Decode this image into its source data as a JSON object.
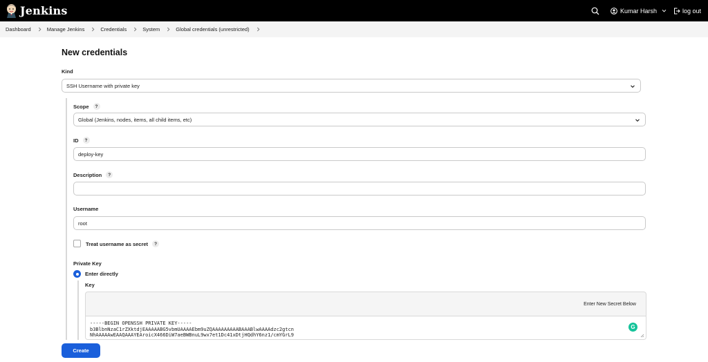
{
  "app": {
    "name": "Jenkins",
    "user_name": "Kumar Harsh",
    "logout_label": "log out",
    "accent_color": "#1a5fdb"
  },
  "breadcrumb": [
    "Dashboard",
    "Manage Jenkins",
    "Credentials",
    "System",
    "Global credentials (unrestricted)"
  ],
  "form": {
    "title": "New credentials",
    "kind": {
      "label": "Kind",
      "value": "SSH Username with private key"
    },
    "scope": {
      "label": "Scope",
      "value": "Global (Jenkins, nodes, items, all child items, etc)"
    },
    "id": {
      "label": "ID",
      "value": "deploy-key"
    },
    "description": {
      "label": "Description",
      "value": ""
    },
    "username": {
      "label": "Username",
      "value": "root"
    },
    "username_secret": {
      "label": "Treat username as secret",
      "checked": false
    },
    "private_key": {
      "label": "Private Key",
      "option_label": "Enter directly",
      "selected": true,
      "key_label": "Key",
      "secret_header": "Enter New Secret Below",
      "value": "-----BEGIN OPENSSH PRIVATE KEY-----\nb3BlbnNzaC1rZXktdjEAAAAABG5vbmUAAAAEbm9uZQAAAAAAAAABAAABlwAAAAdzc2gtcn\nNhAAAAAwEAAQAAAYEAroicX466DiW7aeBWBnuL9wx7et1Dc41xDtjHQdhY6nz1/cmYGrL9"
    },
    "help_glyph": "?",
    "create_label": "Create"
  },
  "icons": {
    "logo": "jenkins-butler-logo",
    "search": "search-icon",
    "user": "user-icon",
    "logout": "logout-icon",
    "grammarly": "grammarly-icon",
    "grammarly_glyph": "G"
  }
}
